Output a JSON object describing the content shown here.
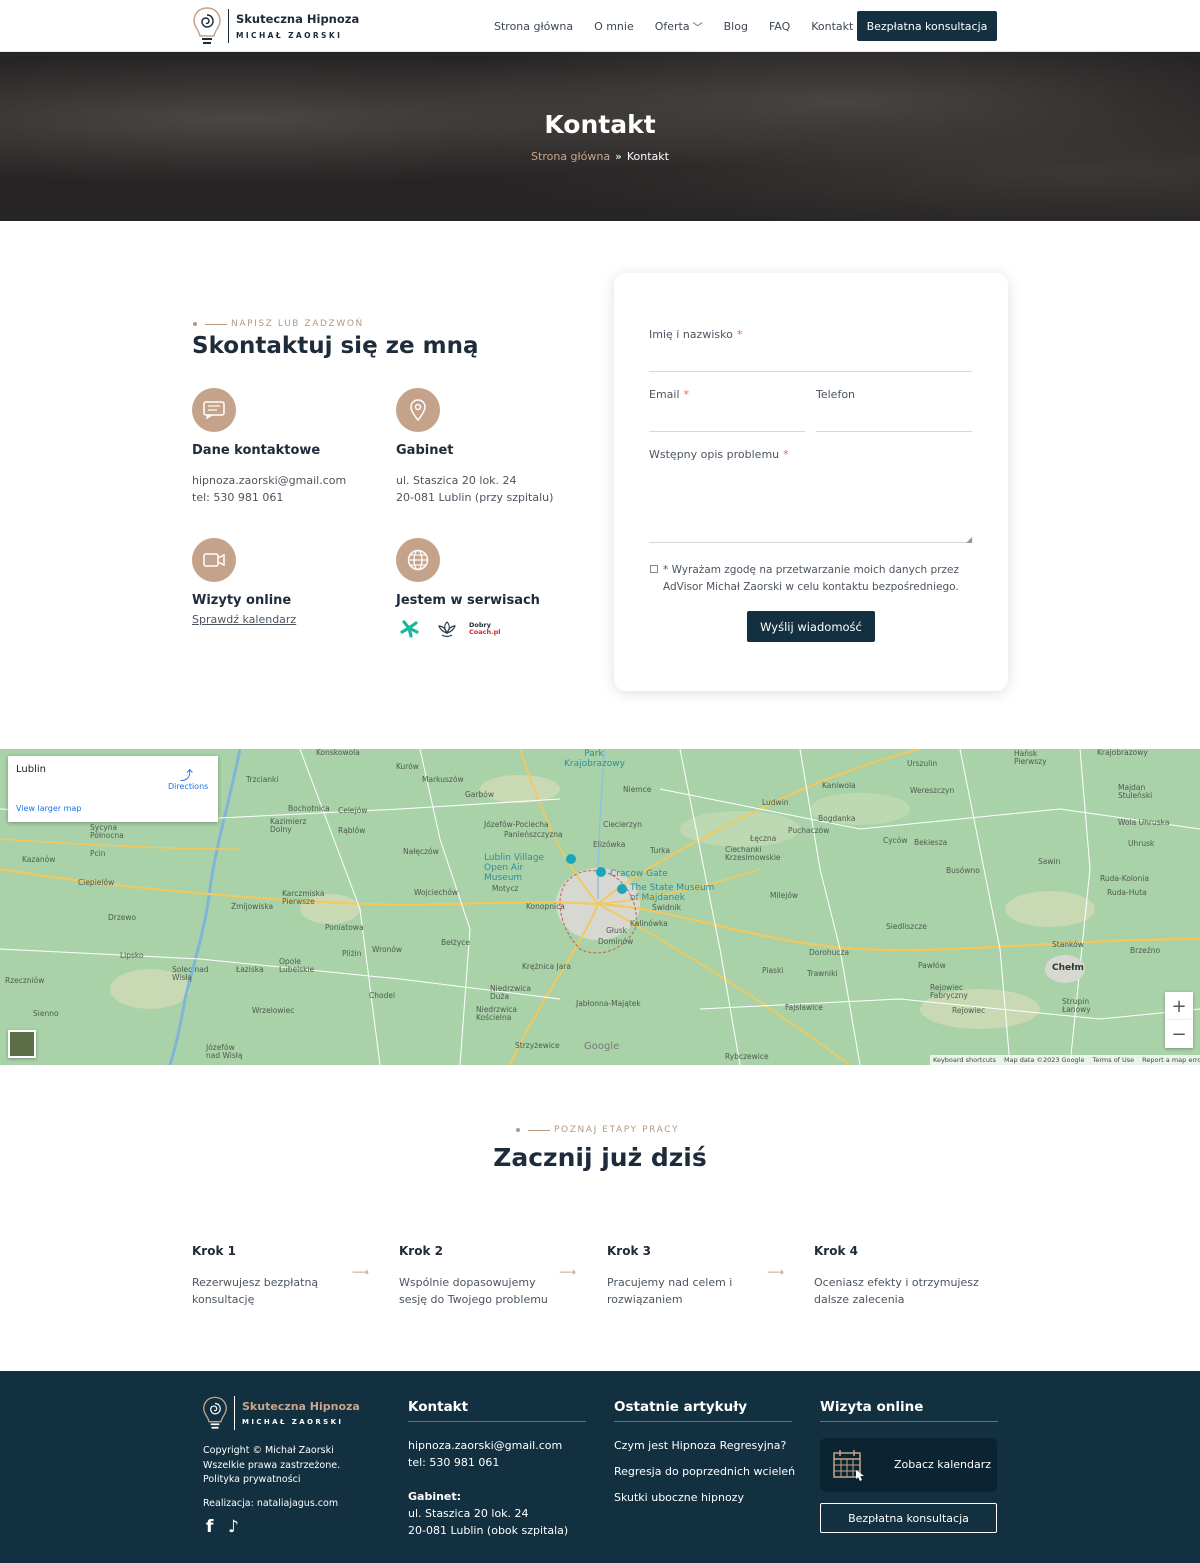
{
  "brand": {
    "name": "Skuteczna Hipnoza",
    "owner": "MICHAŁ ZAORSKI"
  },
  "nav": {
    "items": [
      "Strona główna",
      "O mnie",
      "Oferta",
      "Blog",
      "FAQ",
      "Kontakt"
    ],
    "cta": "Bezpłatna konsultacja"
  },
  "hero": {
    "title": "Kontakt",
    "breadcrumb_home": "Strona główna",
    "breadcrumb_sep": "»",
    "breadcrumb_current": "Kontakt"
  },
  "contact": {
    "kicker": "NAPISZ LUB ZADZWOŃ",
    "title": "Skontaktuj się ze mną",
    "blocks": {
      "details": {
        "title": "Dane kontaktowe",
        "email": "hipnoza.zaorski@gmail.com",
        "phone": "tel: 530 981 061",
        "icon": "chat-icon"
      },
      "office": {
        "title": "Gabinet",
        "line1": "ul. Staszica 20 lok. 24",
        "line2": "20-081 Lublin (przy szpitalu)",
        "icon": "map-pin-icon"
      },
      "online": {
        "title": "Wizyty online",
        "link": "Sprawdź kalendarz",
        "icon": "video-camera-icon"
      },
      "services": {
        "title": "Jestem w serwisach",
        "icon": "globe-icon",
        "badge_dobry": "Dobry",
        "badge_coach": "Coach.pl"
      }
    }
  },
  "form": {
    "name_label": "Imię i nazwisko",
    "email_label": "Email",
    "phone_label": "Telefon",
    "problem_label": "Wstępny opis problemu",
    "required_mark": "*",
    "consent": "* Wyrażam zgodę na przetwarzanie moich danych przez AdVisor Michał Zaorski w celu kontaktu bezpośredniego.",
    "submit": "Wyślij wiadomość"
  },
  "map": {
    "place": "Lublin",
    "directions": "Directions",
    "larger": "View larger map",
    "zoom_in": "+",
    "zoom_out": "−",
    "google": "Google",
    "attribution": [
      "Keyboard shortcuts",
      "Map data ©2023 Google",
      "Terms of Use",
      "Report a map error"
    ],
    "towns": [
      {
        "name": "Konskowola"
      },
      {
        "name": "Trzcianki"
      },
      {
        "name": "Kurów"
      },
      {
        "name": "Markuszów"
      },
      {
        "name": "Garbów"
      },
      {
        "name": "Bochotnica"
      },
      {
        "name": "Celejów"
      },
      {
        "name": "Kazimierz Dolny"
      },
      {
        "name": "Rąblów"
      },
      {
        "name": "Sycyna Północna"
      },
      {
        "name": "Pcin"
      },
      {
        "name": "Kazanów"
      },
      {
        "name": "Ciepielów"
      },
      {
        "name": "Nałęczów"
      },
      {
        "name": "Wojciechów"
      },
      {
        "name": "Karczmiska Pierwsze"
      },
      {
        "name": "Żmijowiska"
      },
      {
        "name": "Drzewo"
      },
      {
        "name": "Poniatowa"
      },
      {
        "name": "Lipsko"
      },
      {
        "name": "Solec nad Wisłą"
      },
      {
        "name": "Łaziska"
      },
      {
        "name": "Opole Lubelskie"
      },
      {
        "name": "Wronów"
      },
      {
        "name": "Pliżin"
      },
      {
        "name": "Bełżyce"
      },
      {
        "name": "Chodel"
      },
      {
        "name": "Rzeczniów"
      },
      {
        "name": "Wrzelowiec"
      },
      {
        "name": "Sienno"
      },
      {
        "name": "Józefów nad Wisłą"
      },
      {
        "name": "Niemce"
      },
      {
        "name": "Józefów-Pociecha"
      },
      {
        "name": "Panieńszczyzna"
      },
      {
        "name": "Ciecierzyn"
      },
      {
        "name": "Elizówka"
      },
      {
        "name": "Turka"
      },
      {
        "name": "Motycz"
      },
      {
        "name": "Konopnica"
      },
      {
        "name": "Świdnik"
      },
      {
        "name": "Kalinówka"
      },
      {
        "name": "Głusk"
      },
      {
        "name": "Dominów"
      },
      {
        "name": "Krężnica Jara"
      },
      {
        "name": "Niedrzwica Duża"
      },
      {
        "name": "Niedrzwica Kościelna"
      },
      {
        "name": "Jabłonna-Majątek"
      },
      {
        "name": "Strzyżewice"
      },
      {
        "name": "Rybczewice"
      },
      {
        "name": "Ludwin"
      },
      {
        "name": "Puchaczów"
      },
      {
        "name": "Łęczna"
      },
      {
        "name": "Ciechanki Krzesimowskie"
      },
      {
        "name": "Milejów"
      },
      {
        "name": "Piaski"
      },
      {
        "name": "Trawniki"
      },
      {
        "name": "Fajsławice"
      },
      {
        "name": "Dorohucza"
      },
      {
        "name": "Kaniwola"
      },
      {
        "name": "Bogdanka"
      },
      {
        "name": "Cyców"
      },
      {
        "name": "Bekiesza"
      },
      {
        "name": "Busówno"
      },
      {
        "name": "Siedliszcze"
      },
      {
        "name": "Pawłów"
      },
      {
        "name": "Rejowiec Fabryczny"
      },
      {
        "name": "Rejowiec"
      },
      {
        "name": "Wereszczyn"
      },
      {
        "name": "Urszulin"
      },
      {
        "name": "Hańsk Pierwszy"
      },
      {
        "name": "Krajobrazowy"
      },
      {
        "name": "Majdan Stuleński"
      },
      {
        "name": "Wola Uhruska"
      },
      {
        "name": "Uhrusk"
      },
      {
        "name": "Sawin"
      },
      {
        "name": "Ruda-Kolonia"
      },
      {
        "name": "Ruda-Huta"
      },
      {
        "name": "Stanków"
      },
      {
        "name": "Brzeźno"
      },
      {
        "name": "Strupin Łanowy"
      }
    ],
    "city": "Chełm",
    "pois": [
      "Park Krajobrazowy",
      "Lublin Village Open Air Museum",
      "Cracow Gate",
      "The State Museum of Majdanek"
    ]
  },
  "steps_section": {
    "kicker": "POZNAJ ETAPY PRACY",
    "title": "Zacznij już dziś",
    "arrow": "⟶",
    "steps": [
      {
        "title": "Krok 1",
        "text": "Rezerwujesz bezpłatną konsultację"
      },
      {
        "title": "Krok 2",
        "text": "Wspólnie dopasowujemy sesję do Twojego problemu"
      },
      {
        "title": "Krok 3",
        "text": "Pracujemy nad celem i rozwiązaniem"
      },
      {
        "title": "Krok 4",
        "text": "Oceniasz efekty i otrzymujesz dalsze zalecenia"
      }
    ]
  },
  "footer": {
    "copyright": "Copyright © Michał Zaorski",
    "rights": "Wszelkie prawa zastrzeżone.",
    "privacy": "Polityka prywatności",
    "credit": "Realizacja: nataliajagus.com",
    "contact_title": "Kontakt",
    "email": "hipnoza.zaorski@gmail.com",
    "phone": "tel: 530 981 061",
    "office_label": "Gabinet:",
    "office_line1": "ul. Staszica 20 lok. 24",
    "office_line2": "20-081 Lublin (obok szpitala)",
    "articles_title": "Ostatnie artykuły",
    "articles": [
      "Czym jest Hipnoza Regresyjna?",
      "Regresja do poprzednich wcieleń",
      "Skutki uboczne hipnozy"
    ],
    "online_title": "Wizyta online",
    "calendar": "Zobacz kalendarz",
    "cta": "Bezpłatna konsultacja",
    "social": [
      "facebook-icon",
      "tiktok-icon"
    ]
  },
  "colors": {
    "accent": "#c4a38a",
    "navy": "#12303f",
    "map_green": "#a9d2a9"
  }
}
